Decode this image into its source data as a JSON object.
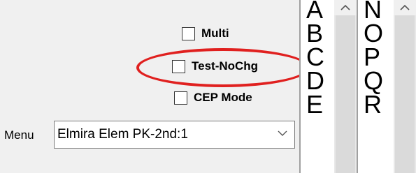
{
  "checkboxes": [
    {
      "label": "Multi",
      "checked": false
    },
    {
      "label": "Test-NoChg",
      "checked": false
    },
    {
      "label": "CEP Mode",
      "checked": false
    }
  ],
  "menu": {
    "label": "Menu",
    "value": "Elmira Elem PK-2nd:1"
  },
  "list_left": [
    "A",
    "B",
    "C",
    "D",
    "E"
  ],
  "list_right": [
    "N",
    "O",
    "P",
    "Q",
    "R"
  ],
  "colors": {
    "highlight": "#e0201f"
  }
}
